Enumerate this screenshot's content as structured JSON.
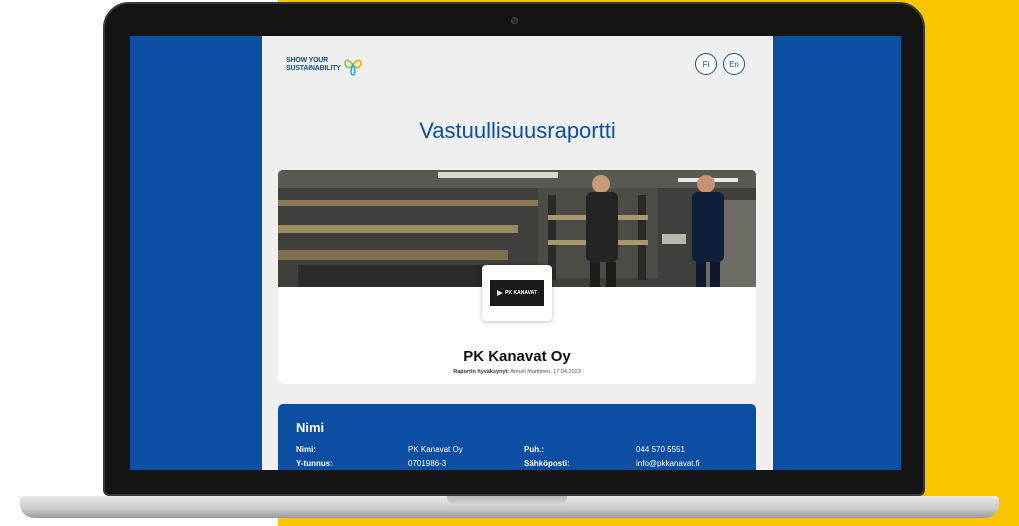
{
  "header": {
    "logo_line1": "SHOW YOUR",
    "logo_line2": "SUSTAINABILITY",
    "lang_fi": "Fi",
    "lang_en": "En"
  },
  "page_title": "Vastuullisuusraportti",
  "company": {
    "logo_text": "PK KANAVAT",
    "name": "PK Kanavat Oy",
    "approved_label": "Raportin hyväksynyt:",
    "approved_value": "Anneli Marttinen, 17.04.2023"
  },
  "info": {
    "title": "Nimi",
    "rows": [
      {
        "label": "Nimi:",
        "value": "PK Kanavat Oy"
      },
      {
        "label": "Y-tunnus:",
        "value": "0701986-3"
      },
      {
        "label": "Puh.:",
        "value": "044 570 5551"
      },
      {
        "label": "Sähköposti:",
        "value": "info@pkkanavat.fi"
      }
    ]
  },
  "colors": {
    "brand_blue": "#0b4ea2",
    "background_yellow": "#f9c400",
    "page_bg": "#efefef"
  }
}
